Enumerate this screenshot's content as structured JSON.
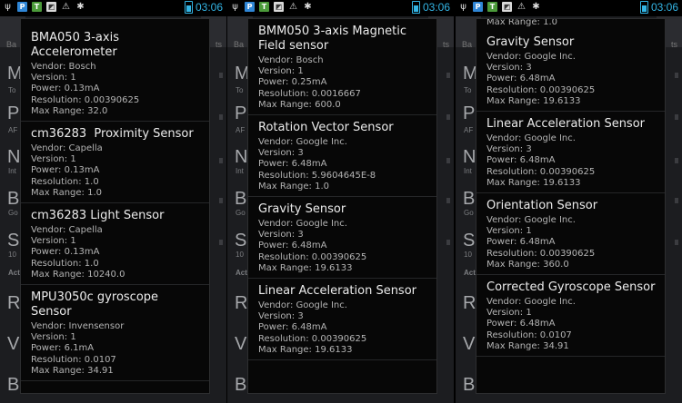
{
  "status_bar": {
    "time": "03:06",
    "icons": [
      "usb-icon",
      "p-icon",
      "t-icon",
      "image-icon",
      "alert-icon",
      "bug-icon",
      "battery-charging-icon"
    ]
  },
  "background": {
    "left_tab": "Ba",
    "right_tab": "ts",
    "letters": [
      "M",
      "P",
      "N",
      "B",
      "S",
      "R",
      "V",
      "B"
    ],
    "subs": [
      "To",
      "AF",
      "Int",
      "Go",
      "10",
      "Acti"
    ]
  },
  "panels": [
    {
      "top_fragment": "",
      "sensors": [
        {
          "name": "BMA050 3-axis Accelerometer",
          "vendor": "Vendor: Bosch",
          "version": "Version: 1",
          "power": "Power: 0.13mA",
          "resolution": "Resolution: 0.00390625",
          "max_range": "Max Range: 32.0"
        },
        {
          "name": "cm36283  Proximity Sensor",
          "vendor": "Vendor: Capella",
          "version": "Version: 1",
          "power": "Power: 0.13mA",
          "resolution": "Resolution: 1.0",
          "max_range": "Max Range: 1.0"
        },
        {
          "name": "cm36283 Light Sensor",
          "vendor": "Vendor: Capella",
          "version": "Version: 1",
          "power": "Power: 0.13mA",
          "resolution": "Resolution: 1.0",
          "max_range": "Max Range: 10240.0"
        },
        {
          "name": "MPU3050c gyroscope Sensor",
          "vendor": "Vendor: Invensensor",
          "version": "Version: 1",
          "power": "Power: 6.1mA",
          "resolution": "Resolution: 0.0107",
          "max_range": "Max Range: 34.91"
        }
      ]
    },
    {
      "top_fragment": "",
      "sensors": [
        {
          "name": "BMM050 3-axis Magnetic Field sensor",
          "vendor": "Vendor: Bosch",
          "version": "Version: 1",
          "power": "Power: 0.25mA",
          "resolution": "Resolution: 0.0016667",
          "max_range": "Max Range: 600.0"
        },
        {
          "name": "Rotation Vector Sensor",
          "vendor": "Vendor: Google Inc.",
          "version": "Version: 3",
          "power": "Power: 6.48mA",
          "resolution": "Resolution: 5.9604645E-8",
          "max_range": "Max Range: 1.0"
        },
        {
          "name": "Gravity Sensor",
          "vendor": "Vendor: Google Inc.",
          "version": "Version: 3",
          "power": "Power: 6.48mA",
          "resolution": "Resolution: 0.00390625",
          "max_range": "Max Range: 19.6133"
        },
        {
          "name": "Linear Acceleration Sensor",
          "vendor": "Vendor: Google Inc.",
          "version": "Version: 3",
          "power": "Power: 6.48mA",
          "resolution": "Resolution: 0.00390625",
          "max_range": "Max Range: 19.6133"
        }
      ]
    },
    {
      "top_fragment": "Max Range: 1.0",
      "sensors": [
        {
          "name": "Gravity Sensor",
          "vendor": "Vendor: Google Inc.",
          "version": "Version: 3",
          "power": "Power: 6.48mA",
          "resolution": "Resolution: 0.00390625",
          "max_range": "Max Range: 19.6133"
        },
        {
          "name": "Linear Acceleration Sensor",
          "vendor": "Vendor: Google Inc.",
          "version": "Version: 3",
          "power": "Power: 6.48mA",
          "resolution": "Resolution: 0.00390625",
          "max_range": "Max Range: 19.6133"
        },
        {
          "name": "Orientation Sensor",
          "vendor": "Vendor: Google Inc.",
          "version": "Version: 1",
          "power": "Power: 6.48mA",
          "resolution": "Resolution: 0.00390625",
          "max_range": "Max Range: 360.0"
        },
        {
          "name": "Corrected Gyroscope Sensor",
          "vendor": "Vendor: Google Inc.",
          "version": "Version: 1",
          "power": "Power: 6.48mA",
          "resolution": "Resolution: 0.0107",
          "max_range": "Max Range: 34.91"
        }
      ]
    }
  ]
}
